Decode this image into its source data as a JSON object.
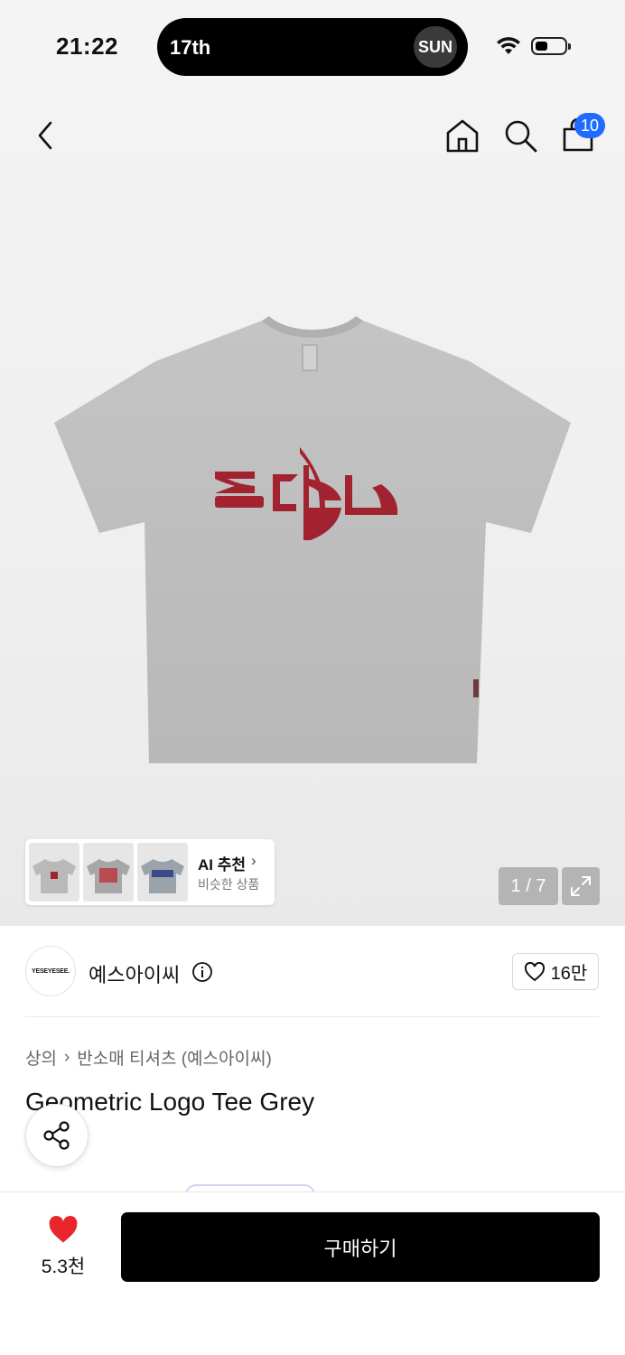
{
  "status_bar": {
    "time": "21:22",
    "island_date": "17th",
    "island_day": "SUN"
  },
  "nav": {
    "cart_count": "10",
    "icons": [
      "chevron-left-icon",
      "home-icon",
      "search-icon",
      "shopping-bag-icon"
    ]
  },
  "gallery": {
    "ai_title": "AI 추천",
    "ai_subtitle": "비슷한 상품",
    "pager": "1 / 7",
    "logo_color": "#a3222f"
  },
  "brand": {
    "logo_text": "YESEYESEE.",
    "name": "예스아이씨",
    "likes": "16만"
  },
  "breadcrumb": {
    "category": "상의",
    "subcategory": "반소매 티셔츠 (예스아이씨)"
  },
  "product": {
    "title": "Geometric Logo Tee Grey"
  },
  "bottom": {
    "wish_count": "5.3천",
    "buy_label": "구매하기",
    "heart_color": "#e8262b"
  }
}
